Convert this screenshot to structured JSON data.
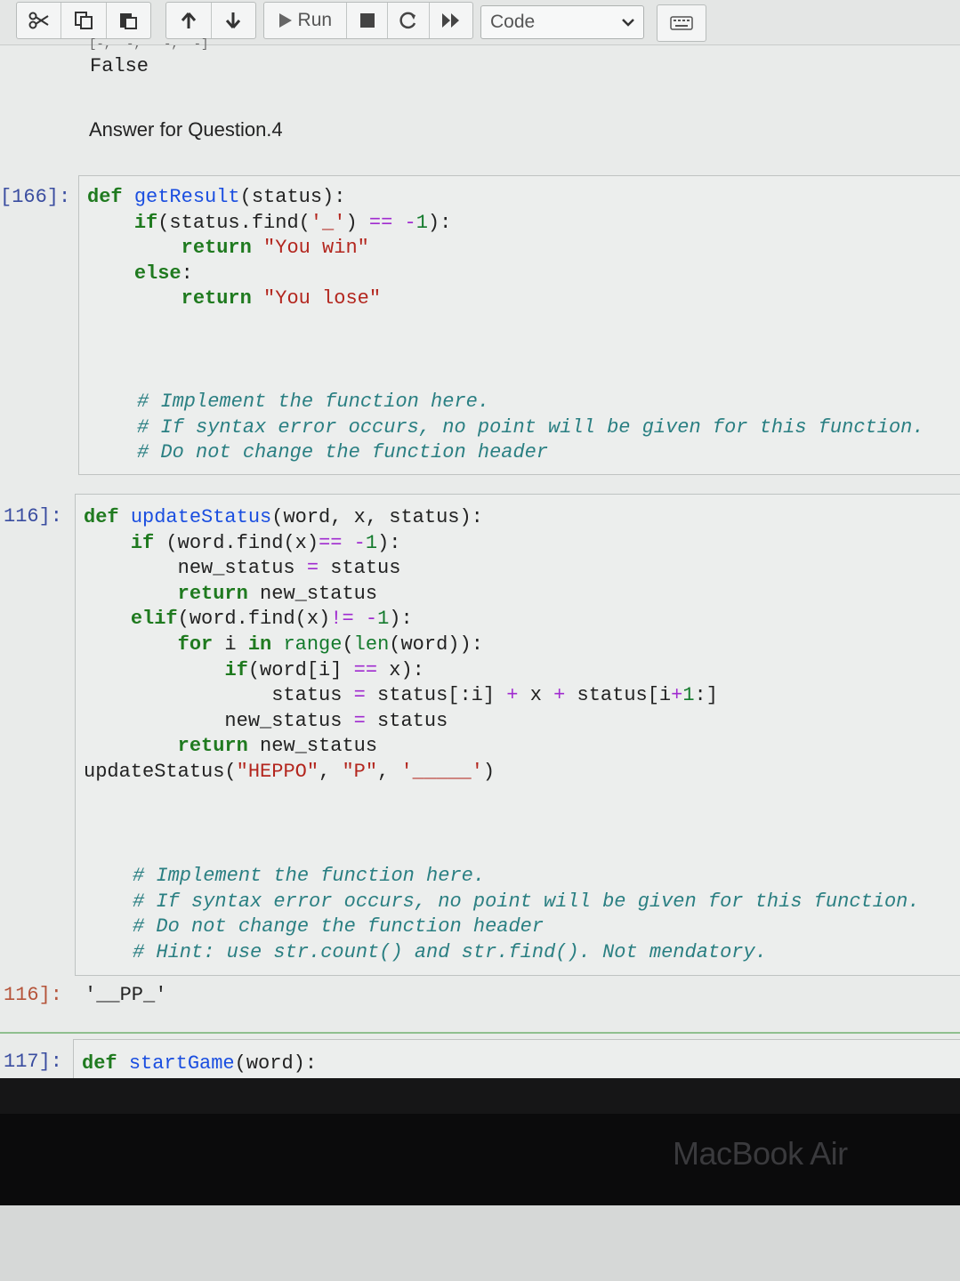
{
  "toolbar": {
    "run_label": "Run",
    "cell_type": "Code",
    "icons": [
      "cut-icon",
      "copy-icon",
      "paste-icon",
      "move-up-icon",
      "move-down-icon",
      "run-icon",
      "stop-icon",
      "restart-icon",
      "fast-forward-icon",
      "chevron-down-icon",
      "keyboard-icon"
    ]
  },
  "notebook": {
    "prev_output_partial": "[-,  -,   -,  -]",
    "prev_output": "False",
    "markdown": "Answer for Question.4",
    "cells": [
      {
        "prompt": "[166]:",
        "code": [
          "def getResult(status):",
          "    if(status.find('_') == -1):",
          "        return \"You win\"",
          "    else:",
          "        return \"You lose\""
        ],
        "comments": [
          "# Implement the function here.",
          "# If syntax error occurs, no point will be given for this function.",
          "# Do not change the function header"
        ]
      },
      {
        "prompt": "116]:",
        "code": [
          "def updateStatus(word, x, status):",
          "    if (word.find(x)== -1):",
          "        new_status = status",
          "        return new_status",
          "    elif(word.find(x)!= -1):",
          "        for i in range(len(word)):",
          "            if(word[i] == x):",
          "                status = status[:i] + x + status[i+1:]",
          "            new_status = status",
          "        return new_status",
          "updateStatus(\"HEPPO\", \"P\", '_____')"
        ],
        "comments": [
          "# Implement the function here.",
          "# If syntax error occurs, no point will be given for this function.",
          "# Do not change the function header",
          "# Hint: use str.count() and str.find(). Not mendatory."
        ],
        "out_prompt": "116]:",
        "output": "'__PP_'"
      },
      {
        "prompt": "117]:",
        "code": [
          "def startGame(word):"
        ]
      }
    ]
  },
  "device": {
    "label": "MacBook Air"
  }
}
